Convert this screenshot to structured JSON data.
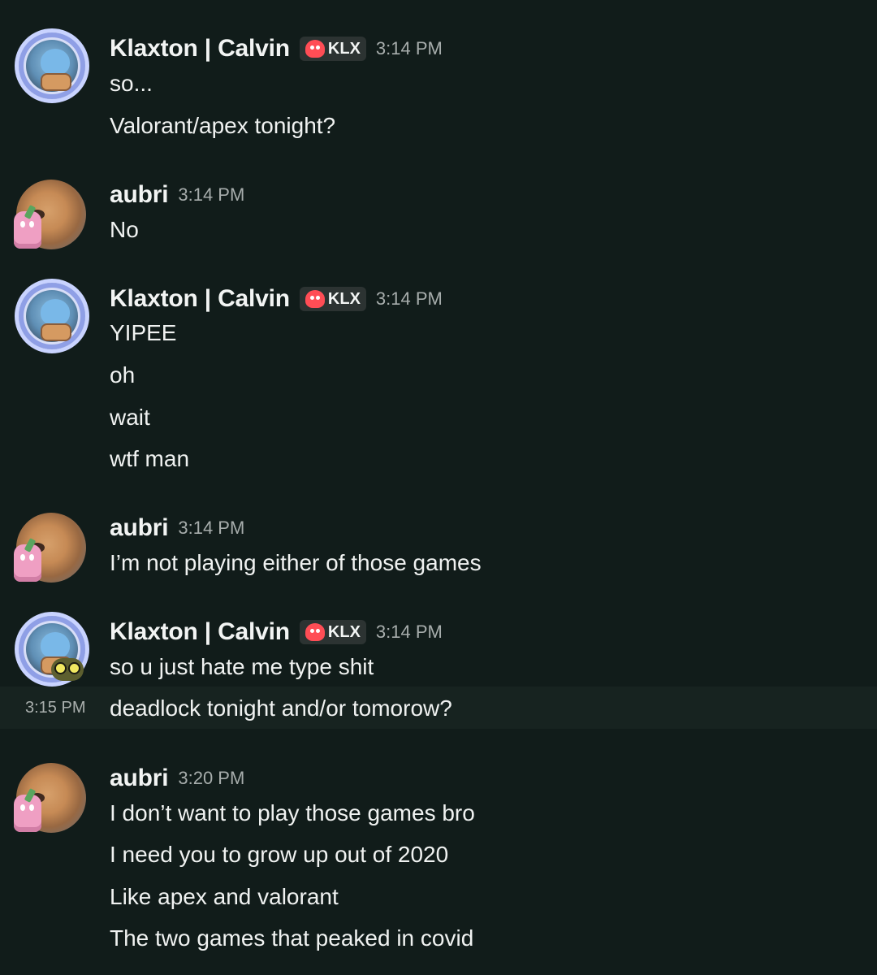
{
  "messages": [
    {
      "author": "Klaxton | Calvin",
      "badge": "KLX",
      "time": "3:14 PM",
      "lines": [
        "so...",
        "Valorant/apex tonight?"
      ]
    },
    {
      "author": "aubri",
      "time": "3:14 PM",
      "lines": [
        "No"
      ]
    },
    {
      "author": "Klaxton | Calvin",
      "badge": "KLX",
      "time": "3:14 PM",
      "lines": [
        "YIPEE",
        "oh",
        "wait",
        "wtf man"
      ]
    },
    {
      "author": "aubri",
      "time": "3:14 PM",
      "lines": [
        "I’m not playing either of those games"
      ]
    },
    {
      "author": "Klaxton | Calvin",
      "badge": "KLX",
      "time": "3:14 PM",
      "lines": [
        "so u just hate me type shit",
        "deadlock tonight and/or tomorow?"
      ],
      "hover_time": "3:15 PM"
    },
    {
      "author": "aubri",
      "time": "3:20 PM",
      "lines": [
        "I don’t want to play those games bro",
        "I need you to grow up out of 2020",
        "Like apex and valorant",
        "The two games that peaked in covid"
      ]
    }
  ],
  "icons": {
    "calvin_avatar": "blue-creature-avatar",
    "aubri_avatar": "capybara-avatar",
    "role_badge": "skull-icon",
    "avatar_decoration": "pink-bunny-decoration",
    "eyes_decoration": "yellow-eyes-decoration"
  },
  "colors": {
    "background": "#111c1a",
    "hover_row": "#172320",
    "text": "#f0f2f1",
    "timestamp": "#a7adac",
    "badge_background": "#2c3332",
    "skull": "#ff4d55"
  }
}
